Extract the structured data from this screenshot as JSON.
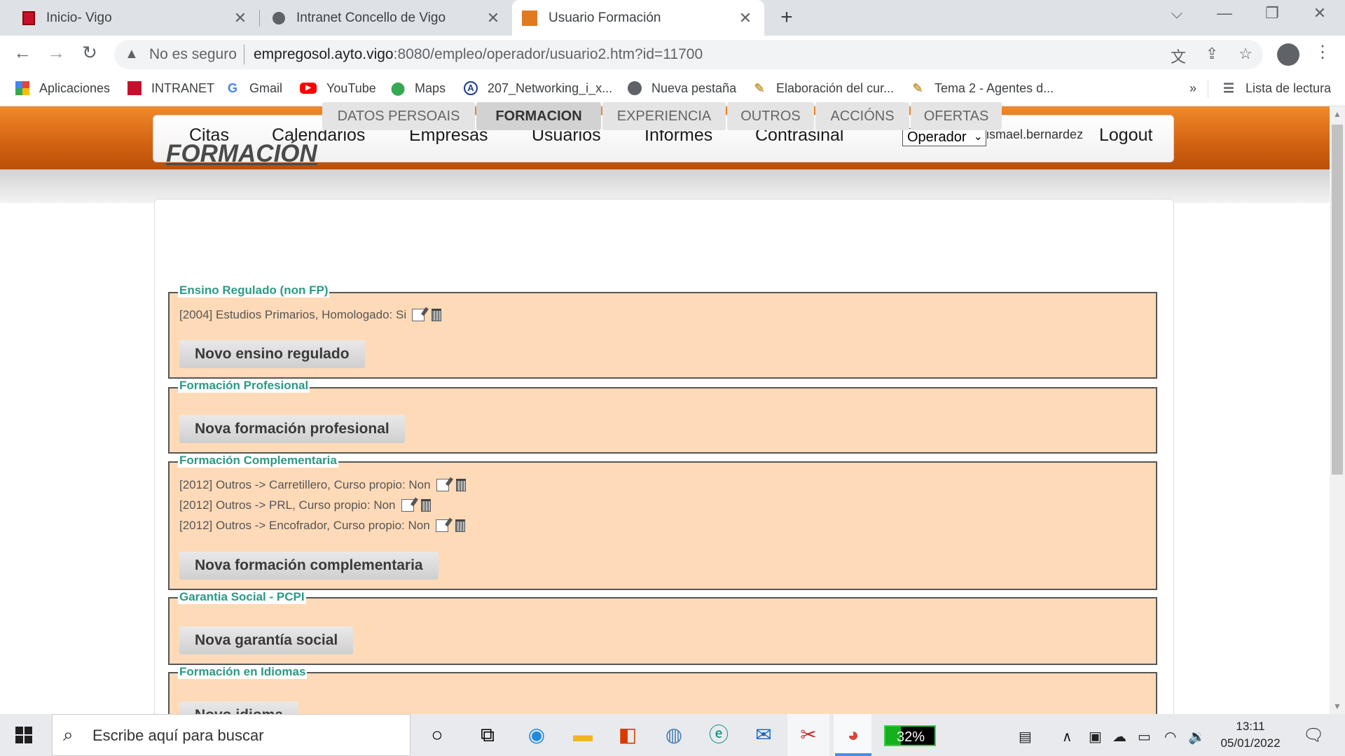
{
  "browser": {
    "tabs": [
      {
        "title": "Inicio- Vigo",
        "close": "✕"
      },
      {
        "title": "Intranet Concello de Vigo",
        "close": "✕"
      },
      {
        "title": "Usuario Formación",
        "close": "✕"
      }
    ],
    "new_tab": "+",
    "security_label": "No es seguro",
    "url_host": "empregosol.ayto.vigo",
    "url_rest": ":8080/empleo/operador/usuario2.htm?id=11700",
    "bookmarks": [
      {
        "label": "Aplicaciones",
        "icon": "apps-grid-icon"
      },
      {
        "label": "INTRANET",
        "icon": "vigo-shield-icon"
      },
      {
        "label": "Gmail",
        "icon": "google-g-icon"
      },
      {
        "label": "YouTube",
        "icon": "youtube-icon"
      },
      {
        "label": "Maps",
        "icon": "maps-pin-icon"
      },
      {
        "label": "207_Networking_i_x...",
        "icon": "cisco-a-icon"
      },
      {
        "label": "Nueva pestaña",
        "icon": "globe-icon"
      },
      {
        "label": "Elaboración del cur...",
        "icon": "pen-icon"
      },
      {
        "label": "Tema 2 - Agentes d...",
        "icon": "pen-icon"
      }
    ],
    "bookmarks_overflow": "»",
    "reading_list": "Lista de lectura"
  },
  "app": {
    "nav": [
      "Citas",
      "Calendarios",
      "Empresas",
      "Usuarios",
      "Informes",
      "Contrasinal"
    ],
    "role_select": "Operador",
    "username": "ismael.bernardez",
    "logout": "Logout",
    "subtabs": [
      "DATOS PERSOAIS",
      "FORMACION",
      "EXPERIENCIA",
      "OUTROS",
      "ACCIÓNS",
      "OFERTAS"
    ],
    "selected_subtab": "FORMACION",
    "page_title": "FORMACIÓN",
    "sections": [
      {
        "legend": "Ensino Regulado (non FP)",
        "items": [
          "[2004] Estudios Primarios, Homologado: Si"
        ],
        "button": "Novo ensino regulado"
      },
      {
        "legend": "Formación Profesional",
        "items": [],
        "button": "Nova formación profesional"
      },
      {
        "legend": "Formación Complementaria",
        "items": [
          "[2012] Outros -> Carretillero, Curso propio: Non",
          "[2012] Outros -> PRL, Curso propio: Non",
          "[2012] Outros -> Encofrador, Curso propio: Non"
        ],
        "button": "Nova formación complementaria"
      },
      {
        "legend": "Garantia Social - PCPI",
        "items": [],
        "button": "Nova garantía social"
      },
      {
        "legend": "Formación en Idiomas",
        "items": [],
        "button": "Novo idioma"
      }
    ],
    "colors": {
      "header_orange": "#e0741b",
      "section_bg": "#ffdab8",
      "legend_teal": "#2a9a86"
    }
  },
  "taskbar": {
    "search_placeholder": "Escribe aquí para buscar",
    "battery": "32%",
    "battery_level": 0.32,
    "time": "13:11",
    "date": "05/01/2022"
  }
}
